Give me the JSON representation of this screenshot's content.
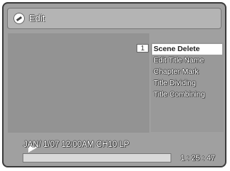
{
  "window": {
    "title": "Edit"
  },
  "icons": {
    "title_icon": "disc-edit-icon",
    "play_icon": "play-icon"
  },
  "video": {
    "chapter_number": "1"
  },
  "menu": {
    "items": [
      {
        "label": "Scene Delete",
        "selected": true
      },
      {
        "label": "Edit Title Name",
        "selected": false
      },
      {
        "label": "Chapter Mark",
        "selected": false
      },
      {
        "label": "Title Dividing",
        "selected": false
      },
      {
        "label": "Title Combining",
        "selected": false
      }
    ]
  },
  "info": {
    "recording": "JAN/ 1/07 12:00AM CH10   LP"
  },
  "progress": {
    "fraction": 0.0
  },
  "time": {
    "elapsed": "1 : 25 : 47"
  }
}
